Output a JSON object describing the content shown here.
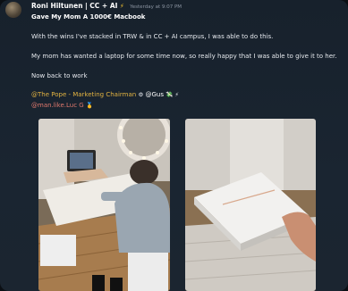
{
  "post": {
    "author": "Roni Hiltunen",
    "author_tag": "| CC + AI",
    "bolt": "⚡",
    "timestamp": "Yesterday at 9:07 PM",
    "title": "Gave My Mom A 1000€ Macbook",
    "line1": "With the wins I've stacked in TRW & in CC + AI campus, I was able to do this.",
    "line2": "My mom has wanted a laptop for some time now, so really happy that I was able to give it to her.",
    "line3": "Now back to work",
    "mention1": "@The Pope - Marketing Chairman",
    "mention1_emoji": "⚙",
    "mention2": "@Gus",
    "mention2_emoji": "💸 ⚡",
    "mention3": "@man.like.Luc G",
    "mention3_emoji": "🥇"
  },
  "images": {
    "left_alt": "Mom at table with new laptop",
    "right_alt": "Hand holding MacBook box"
  }
}
